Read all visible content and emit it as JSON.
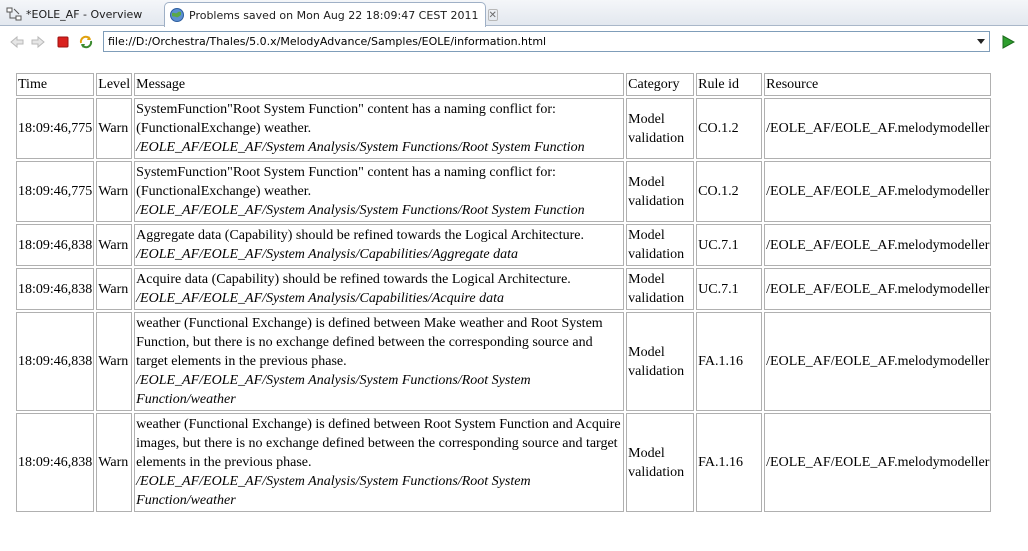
{
  "tabs": [
    {
      "label": "*EOLE_AF - Overview",
      "icon": "diagram-icon",
      "active": false
    },
    {
      "label": "Problems saved on Mon Aug 22 18:09:47 CEST 2011",
      "icon": "globe-icon",
      "active": true
    }
  ],
  "tab_close_glyph": "✕",
  "address": {
    "url": "file://D:/Orchestra/Thales/5.0.x/MelodyAdvance/Samples/EOLE/information.html"
  },
  "table": {
    "headers": {
      "time": "Time",
      "level": "Level",
      "message": "Message",
      "category": "Category",
      "rule": "Rule id",
      "resource": "Resource"
    },
    "rows": [
      {
        "time": "18:09:46,775",
        "level": "Warn",
        "message": "SystemFunction\"Root System Function\" content has a naming conflict for: (FunctionalExchange) weather.",
        "path": "/EOLE_AF/EOLE_AF/System Analysis/System Functions/Root System Function",
        "category": "Model validation",
        "rule": "CO.1.2",
        "resource": "/EOLE_AF/EOLE_AF.melodymodeller"
      },
      {
        "time": "18:09:46,775",
        "level": "Warn",
        "message": "SystemFunction\"Root System Function\" content has a naming conflict for: (FunctionalExchange) weather.",
        "path": "/EOLE_AF/EOLE_AF/System Analysis/System Functions/Root System Function",
        "category": "Model validation",
        "rule": "CO.1.2",
        "resource": "/EOLE_AF/EOLE_AF.melodymodeller"
      },
      {
        "time": "18:09:46,838",
        "level": "Warn",
        "message": "Aggregate data (Capability) should be refined towards the Logical Architecture.",
        "path": "/EOLE_AF/EOLE_AF/System Analysis/Capabilities/Aggregate data",
        "category": "Model validation",
        "rule": "UC.7.1",
        "resource": "/EOLE_AF/EOLE_AF.melodymodeller"
      },
      {
        "time": "18:09:46,838",
        "level": "Warn",
        "message": "Acquire data (Capability) should be refined towards the Logical Architecture.",
        "path": "/EOLE_AF/EOLE_AF/System Analysis/Capabilities/Acquire data",
        "category": "Model validation",
        "rule": "UC.7.1",
        "resource": "/EOLE_AF/EOLE_AF.melodymodeller"
      },
      {
        "time": "18:09:46,838",
        "level": "Warn",
        "message": "weather (Functional Exchange) is defined between Make weather and Root System Function, but there is no exchange defined between the corresponding source and target elements in the previous phase.",
        "path": "/EOLE_AF/EOLE_AF/System Analysis/System Functions/Root System Function/weather",
        "category": "Model validation",
        "rule": "FA.1.16",
        "resource": "/EOLE_AF/EOLE_AF.melodymodeller"
      },
      {
        "time": "18:09:46,838",
        "level": "Warn",
        "message": "weather (Functional Exchange) is defined between Root System Function and Acquire images, but there is no exchange defined between the corresponding source and target elements in the previous phase.",
        "path": "/EOLE_AF/EOLE_AF/System Analysis/System Functions/Root System Function/weather",
        "category": "Model validation",
        "rule": "FA.1.16",
        "resource": "/EOLE_AF/EOLE_AF.melodymodeller"
      }
    ]
  },
  "colors": {
    "tab_border": "#9fb0c6",
    "url_border": "#7f9db9",
    "stop_red": "#d9211e",
    "go_green": "#2e9e2e",
    "cell_border": "#b0b0b0"
  }
}
